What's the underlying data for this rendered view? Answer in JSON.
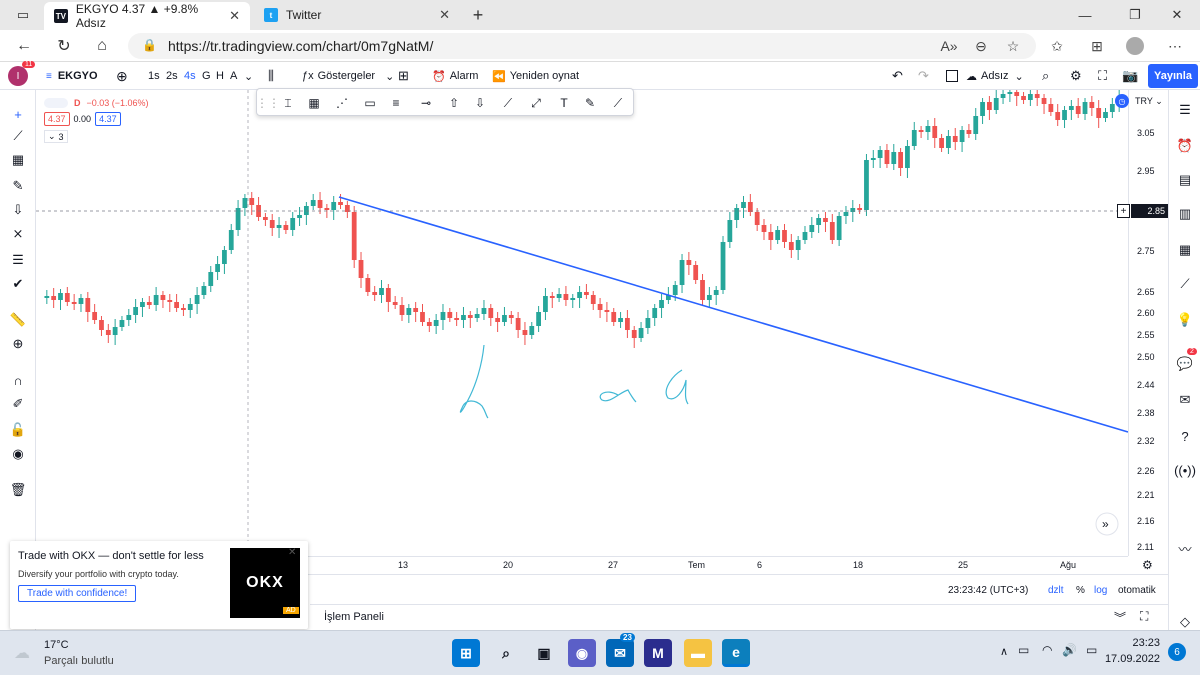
{
  "browser": {
    "tabs": [
      {
        "title": "EKGYO 4.37 ▲ +9.8% Adsız",
        "icon": "tradingview-icon",
        "active": true
      },
      {
        "title": "Twitter",
        "icon": "twitter-icon",
        "active": false
      }
    ],
    "new_tab": "+",
    "url": "https://tr.tradingview.com/chart/0m7gNatM/"
  },
  "toolbar": {
    "avatar_badge": "11",
    "symbol": "EKGYO",
    "intervals": [
      "1s",
      "2s",
      "4s",
      "G",
      "H",
      "A"
    ],
    "indicators": "Göstergeler",
    "alarm": "Alarm",
    "replay": "Yeniden oynat",
    "layout_name": "Adsız",
    "publish": "Yayınla"
  },
  "legend": {
    "interval": "D",
    "change": "−0.03 (−1.06%)",
    "bid": "4.37",
    "spread": "0.00",
    "ask": "4.37",
    "indicator_count": "3"
  },
  "price_scale": {
    "currency": "TRY",
    "ticks": [
      "3.05",
      "2.95",
      "2.85",
      "2.75",
      "2.65",
      "2.60",
      "2.55",
      "2.50",
      "2.44",
      "2.38",
      "2.32",
      "2.26",
      "2.21",
      "2.16",
      "2.11"
    ],
    "crosshair_price": "2.85"
  },
  "time_scale": {
    "labels": [
      "13",
      "20",
      "27",
      "Tem",
      "6",
      "18",
      "25",
      "Ağu"
    ]
  },
  "status": {
    "time": "23:23:42 (UTC+3)",
    "adj": "dzlt",
    "percent": "%",
    "log": "log",
    "auto": "otomatik"
  },
  "panel": {
    "trading_panel": "İşlem Paneli"
  },
  "ad": {
    "title": "Trade with OKX — don't settle for less",
    "body": "Diversify your portfolio with crypto today.",
    "cta": "Trade with confidence!",
    "logo": "OKX",
    "badge": "AD"
  },
  "taskbar": {
    "weather_temp": "17°C",
    "weather_desc": "Parçalı bulutlu",
    "teams_badge": "23",
    "clock_time": "23:23",
    "clock_date": "17.09.2022",
    "notif_count": "6"
  },
  "annotations": {
    "handwriting": [
      "ℒ",
      "∝",
      "∝"
    ]
  },
  "right_sidebar_badge": "2",
  "colors": {
    "up": "#26a69a",
    "down": "#ef5350",
    "trendline": "#2962ff",
    "handwriting": "#41b8d5",
    "brand": "#2962ff"
  }
}
